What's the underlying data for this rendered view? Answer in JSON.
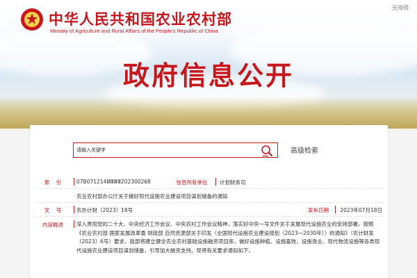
{
  "header": {
    "ministry_cn": "中华人民共和国农业农村部",
    "ministry_en": "Ministry of Agriculture and Rural Affairs of the People's Republic of China",
    "accessibility": "无障碍",
    "banner_title": "政府信息公开"
  },
  "search": {
    "placeholder": "请输入关键字",
    "advanced_label": "高级检索"
  },
  "document": {
    "index_label": "索    引",
    "index_value": "07B071214ⅢⅢⅢⅢ202300268",
    "org_label": "信息所有单位",
    "org_value": "计划财务司",
    "title_value": "农业农村部办公厅关于做好现代设施农业建设项目谋划储备的通知",
    "docno_label": "文    号",
    "docno_value": "农办计财〔2023〕18号",
    "date_label": "发布日期",
    "date_value": "2023年07月18日",
    "summary_label": "内容概述",
    "summary_value": "深入贯彻党的二十大、中央经济工作会议、中央农村工作会议精神，落实好中央一号文件关于发展现代设施农业的安排部署，按照《农业农村部 国家发展改革委 财政部 自然资源部关于印发〈全国现代设施农业建设规划（2023—2030年）〉的通知》（农计财发〔2023〕6号）要求，我部将建立健全农业农村基础设施融资项目库，做好设施种植、设施畜牧、设施渔业、现代物流设施等各类现代设施农业建设项目谋划储备，引导加大融资支持。现将有关要求通知如下。"
  },
  "colors": {
    "brand_red": "#c8161d"
  }
}
